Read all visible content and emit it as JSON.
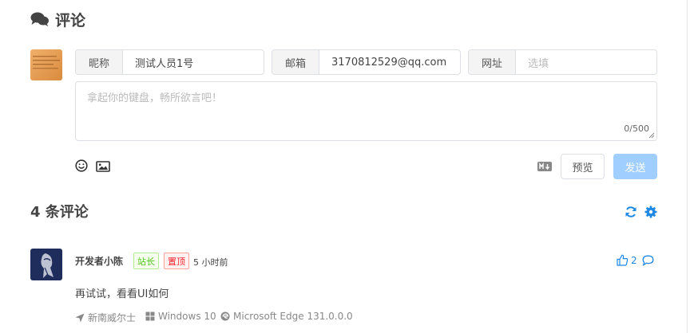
{
  "header": {
    "title": "评论"
  },
  "form": {
    "nick_label": "昵称",
    "nick_value": "测试人员1号",
    "mail_label": "邮箱",
    "mail_value": "3170812529@qq.com",
    "link_label": "网址",
    "link_placeholder": "选填",
    "textarea_placeholder": "拿起你的键盘，畅所欲言吧！",
    "word_count": "0/500",
    "preview_label": "预览",
    "send_label": "发送",
    "markdown_icon": "markdown-icon",
    "emoji_icon": "emoji-icon",
    "image_icon": "image-icon"
  },
  "comments_header": {
    "title": "4 条评论",
    "refresh_icon": "refresh-icon",
    "settings_icon": "gear-icon"
  },
  "comments": [
    {
      "nick": "开发者小陈",
      "badge_owner": "站长",
      "badge_pinned": "置顶",
      "time": "5 小时前",
      "likes": "2",
      "content": "再试试，看看UI如何",
      "location": "新南威尔士",
      "os": "Windows 10",
      "browser": "Microsoft Edge 131.0.0.0"
    }
  ],
  "colors": {
    "accent": "#1e88e5",
    "send_button": "#a0cfff",
    "badge_owner": "#52c41a",
    "badge_pinned": "#f5222d"
  }
}
